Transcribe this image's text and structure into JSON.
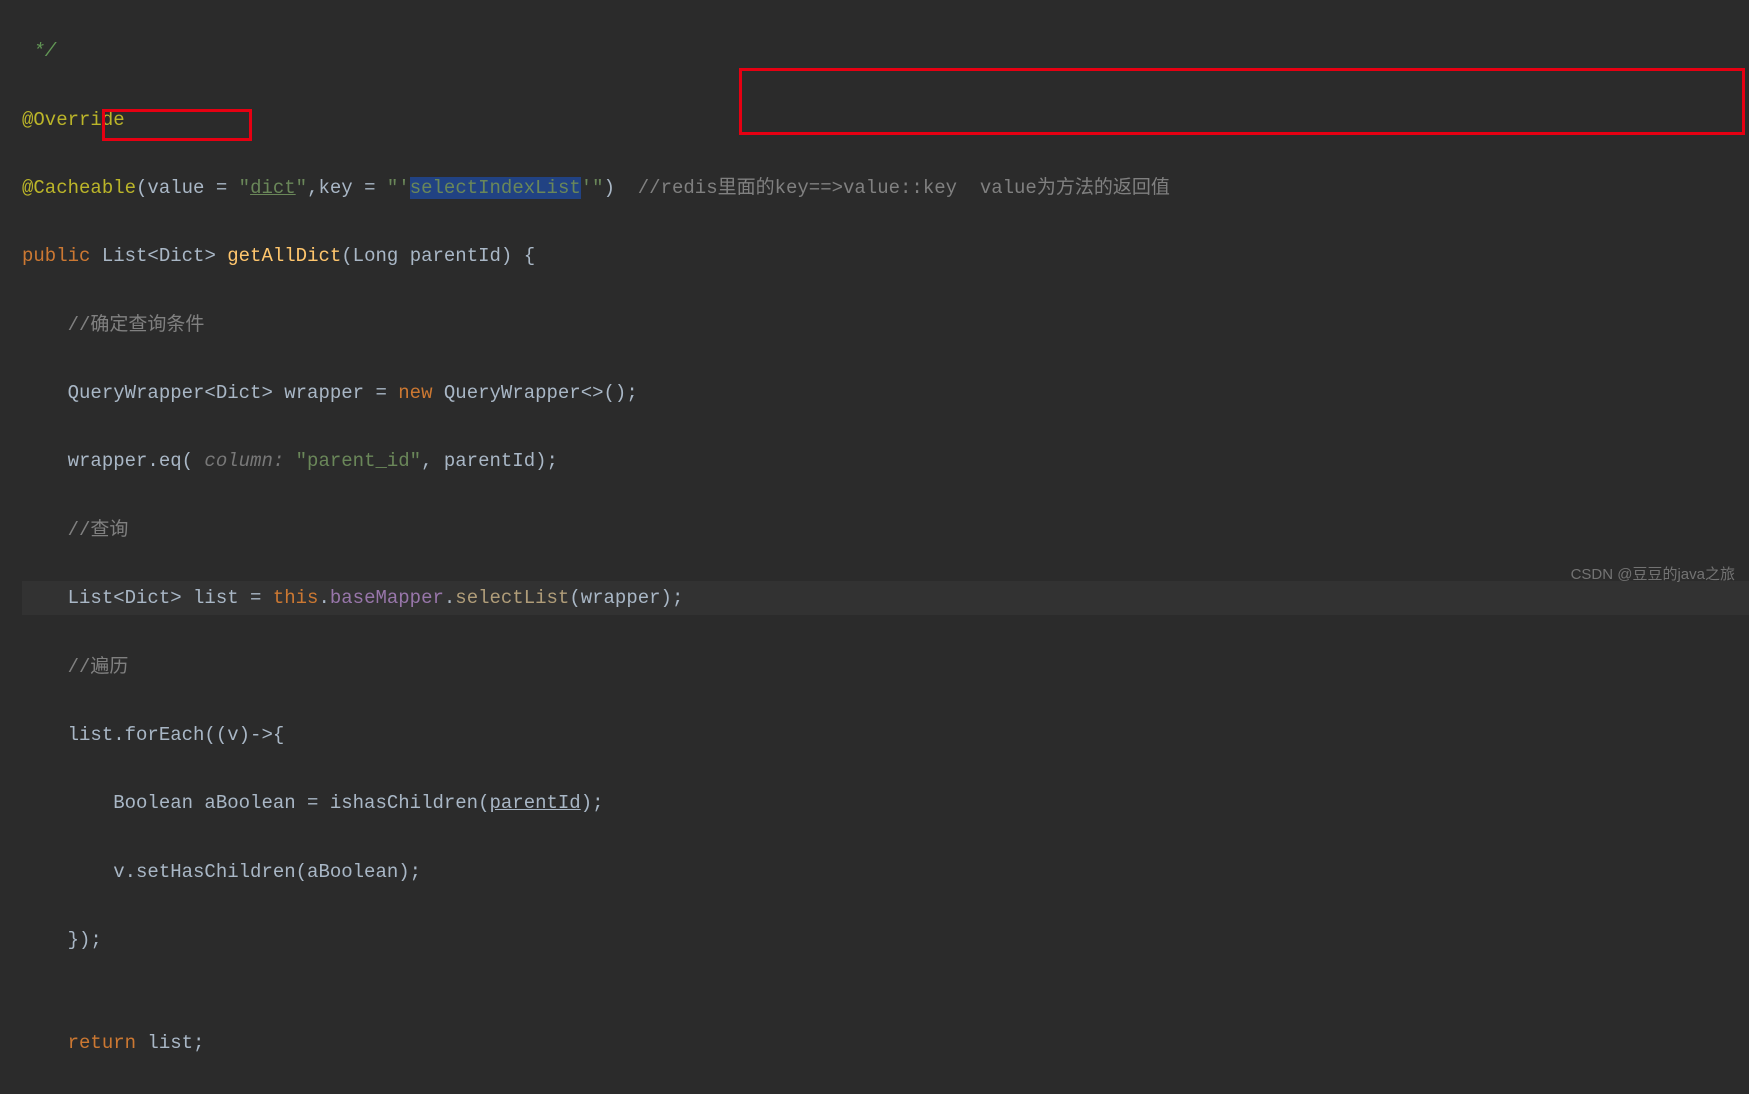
{
  "code": {
    "line1": " */",
    "line2_annot": "@Override",
    "line3": {
      "annot": "@Cacheable",
      "open": "(value = ",
      "str1": "\"",
      "underline": "dict",
      "str1c": "\"",
      "mid": ",key = ",
      "str2a": "\"'",
      "str2b": "selectIndexList",
      "str2c": "'\"",
      "close": ")  ",
      "comment": "//redis里面的key==>value::key  value为方法的返回值"
    },
    "line4": {
      "kw": "public ",
      "type": "List<Dict> ",
      "method": "getAllDict",
      "params": "(Long parentId) {"
    },
    "line5": "    //确定查询条件",
    "line6": {
      "pre": "    QueryWrapper<Dict> wrapper = ",
      "kw": "new",
      "post": " QueryWrapper<>();"
    },
    "line7": {
      "pre": "    wrapper.eq(",
      "hint": " column: ",
      "str": "\"parent_id\"",
      "post": ", parentId);"
    },
    "line8": "    //查询",
    "line9": {
      "pre": "    List<Dict> list = ",
      "kw1": "this",
      "dot1": ".",
      "m1": "baseMapper",
      "dot2": ".",
      "m2": "selectList",
      "post": "(wrapper);"
    },
    "line10": "    //遍历",
    "line11": "    list.forEach((v)->{",
    "line12": {
      "pre": "        Boolean aBoolean = ishasChildren(",
      "under": "parentId",
      "post": ");"
    },
    "line13": "        v.setHasChildren(aBoolean);",
    "line14": "    });",
    "line15": "",
    "line16": {
      "pre": "    ",
      "kw": "return",
      "post": " list;"
    }
  },
  "watermark": "CSDN @豆豆的java之旅"
}
